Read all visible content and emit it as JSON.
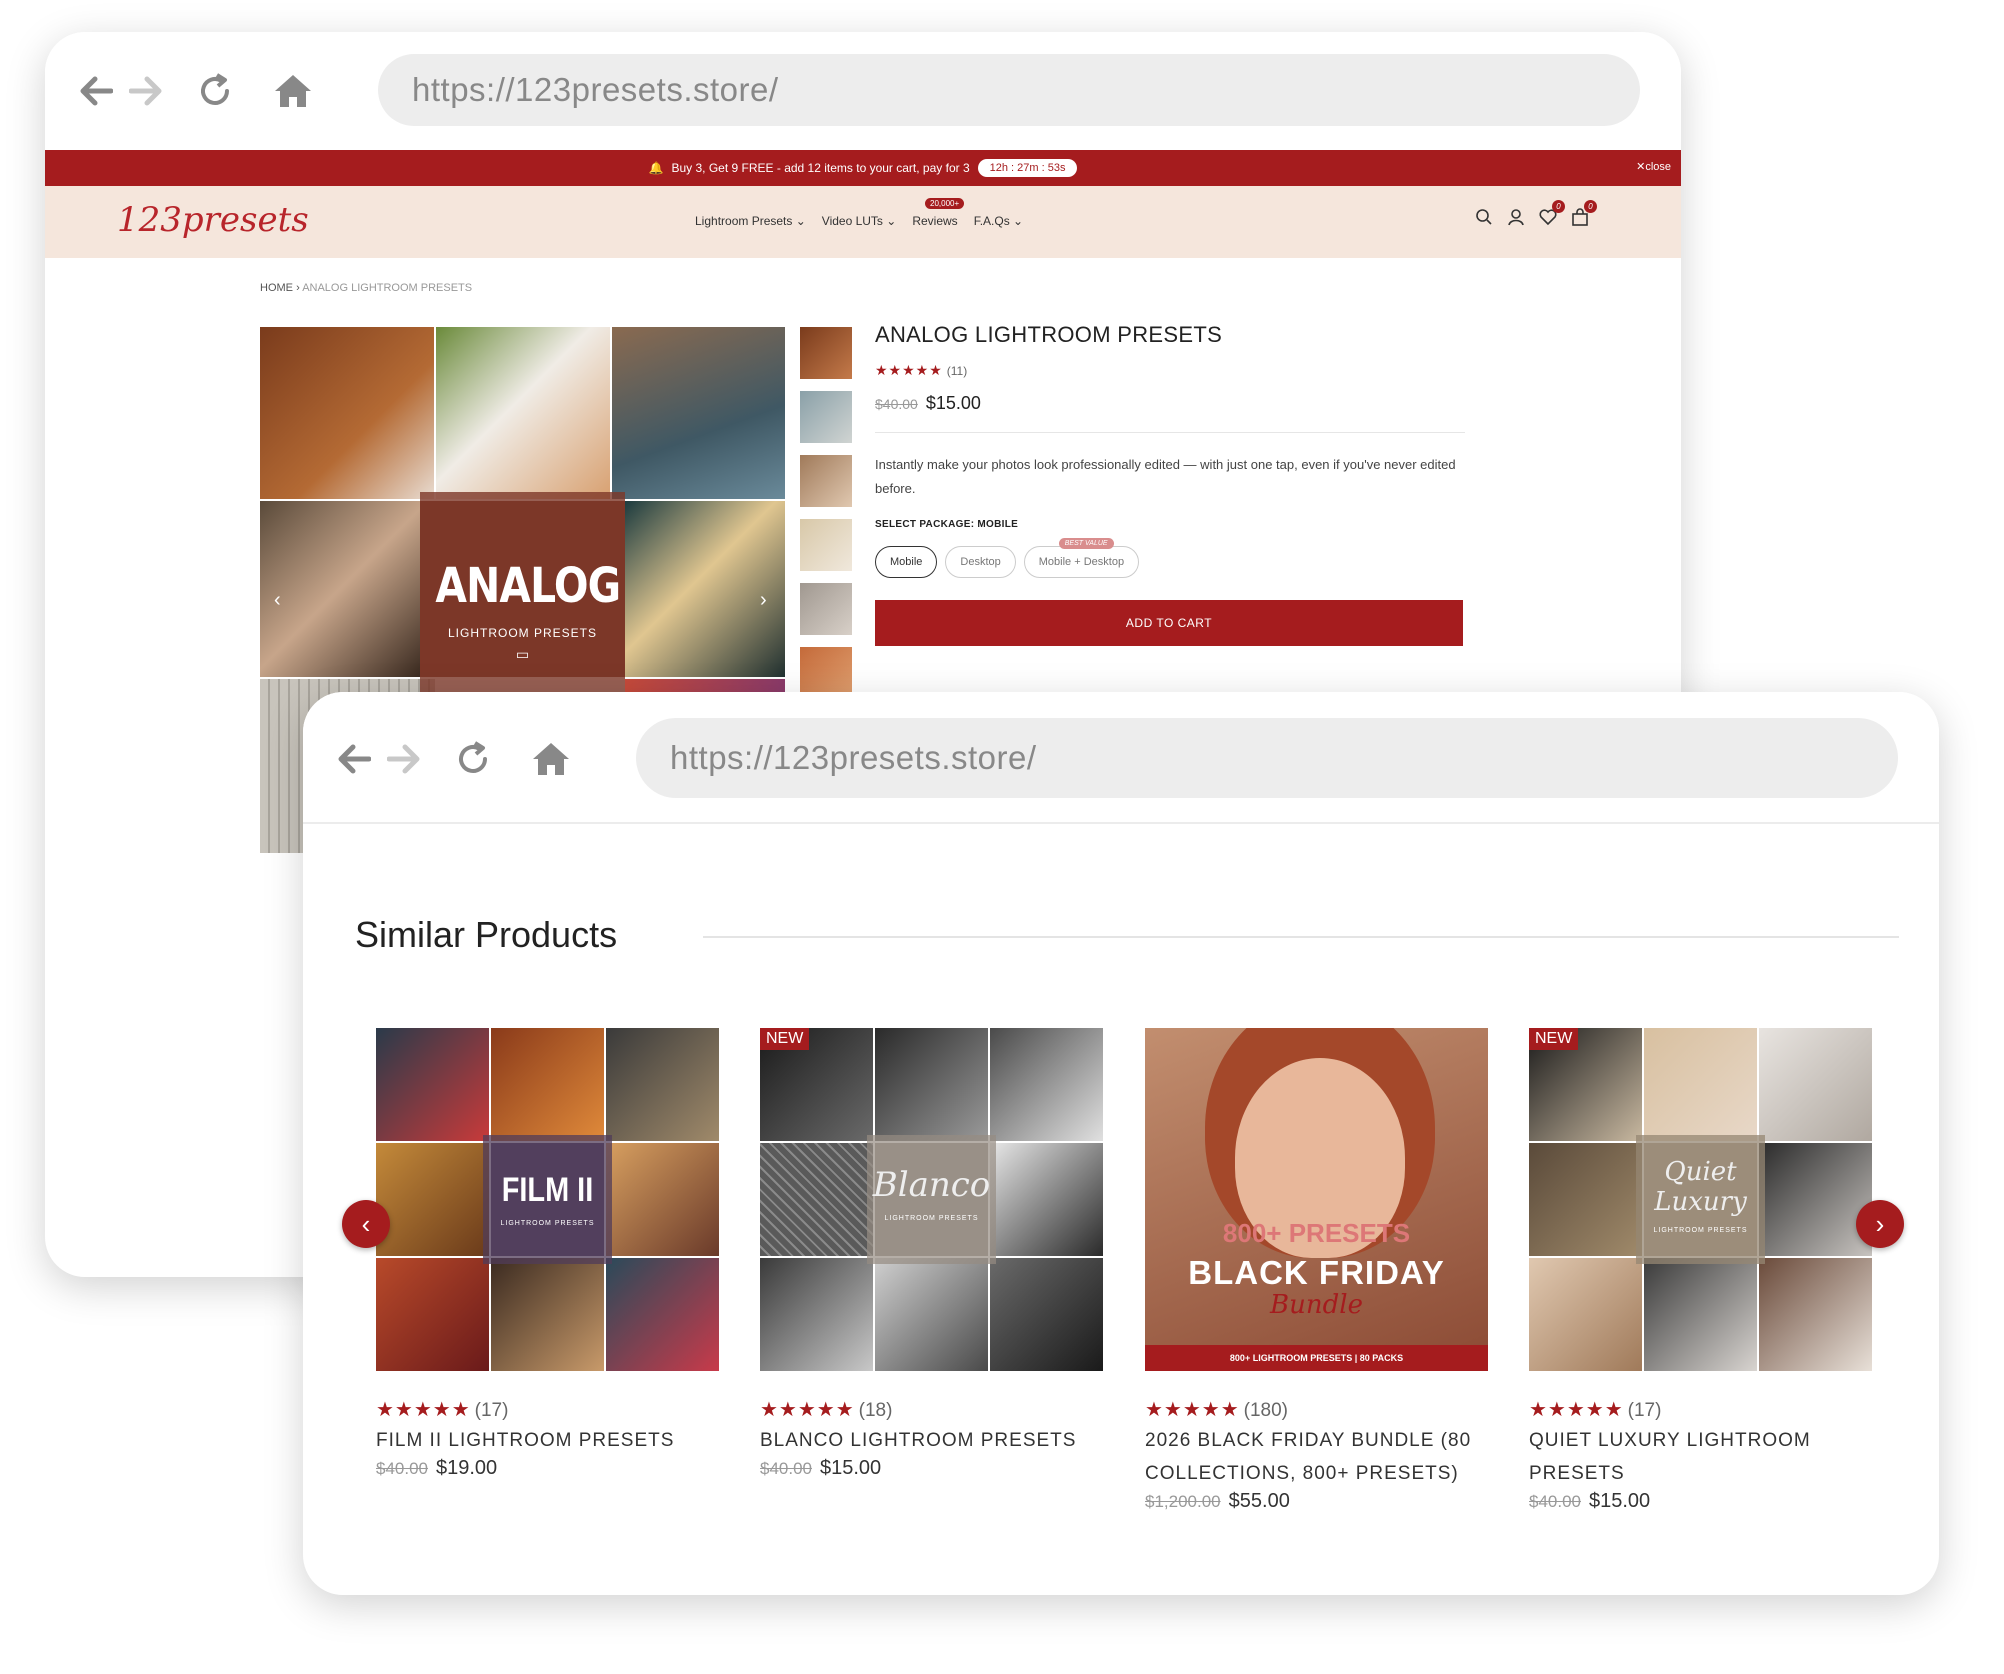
{
  "browser": {
    "url": "https://123presets.store/"
  },
  "promo": {
    "text": "Buy 3, Get 9 FREE - add 12 items to your cart, pay for 3",
    "timer": "12h : 27m : 53s",
    "close": "close"
  },
  "header": {
    "logo": "123presets",
    "menu": [
      "Lightroom Presets",
      "Video LUTs",
      "Reviews",
      "F.A.Qs"
    ],
    "reviews_badge": "20,000+",
    "wishlist_count": "0",
    "cart_count": "0"
  },
  "breadcrumb": {
    "home": "HOME",
    "current": "ANALOG LIGHTROOM PRESETS"
  },
  "gallery": {
    "overlay_title": "ANALOG",
    "overlay_sub": "LIGHTROOM PRESETS"
  },
  "product": {
    "title": "ANALOG LIGHTROOM PRESETS",
    "stars": "★★★★★",
    "review_count": "(11)",
    "old_price": "$40.00",
    "price": "$15.00",
    "description": "Instantly make your photos look professionally edited — with just one tap, even if you've never edited before.",
    "package_label": "SELECT PACKAGE: MOBILE",
    "packages": [
      "Mobile",
      "Desktop",
      "Mobile + Desktop"
    ],
    "best_value": "BEST VALUE",
    "add_to_cart": "ADD TO CART"
  },
  "similar": {
    "title": "Similar Products",
    "new_label": "NEW",
    "items": [
      {
        "title": "FILM II LIGHTROOM PRESETS",
        "stars": "★★★★★",
        "count": "(17)",
        "old_price": "$40.00",
        "price": "$19.00",
        "overlay": "FILM II",
        "overlay_sub": "LIGHTROOM PRESETS"
      },
      {
        "title": "BLANCO LIGHTROOM PRESETS",
        "stars": "★★★★★",
        "count": "(18)",
        "old_price": "$40.00",
        "price": "$15.00",
        "overlay": "Blanco",
        "overlay_sub": "LIGHTROOM PRESETS"
      },
      {
        "title": "2026 BLACK FRIDAY BUNDLE (80 COLLECTIONS, 800+ PRESETS)",
        "stars": "★★★★★",
        "count": "(180)",
        "old_price": "$1,200.00",
        "price": "$55.00",
        "overlay_1": "800+ PRESETS",
        "overlay_2": "BLACK FRIDAY",
        "overlay_3": "Bundle",
        "overlay_bar": "800+ LIGHTROOM PRESETS | 80 PACKS"
      },
      {
        "title": "QUIET LUXURY LIGHTROOM PRESETS",
        "stars": "★★★★★",
        "count": "(17)",
        "old_price": "$40.00",
        "price": "$15.00",
        "overlay": "Quiet Luxury",
        "overlay_sub": "LIGHTROOM PRESETS"
      }
    ]
  },
  "colors": {
    "brand_red": "#a51c1e",
    "header_bg": "#f5e6dc"
  }
}
